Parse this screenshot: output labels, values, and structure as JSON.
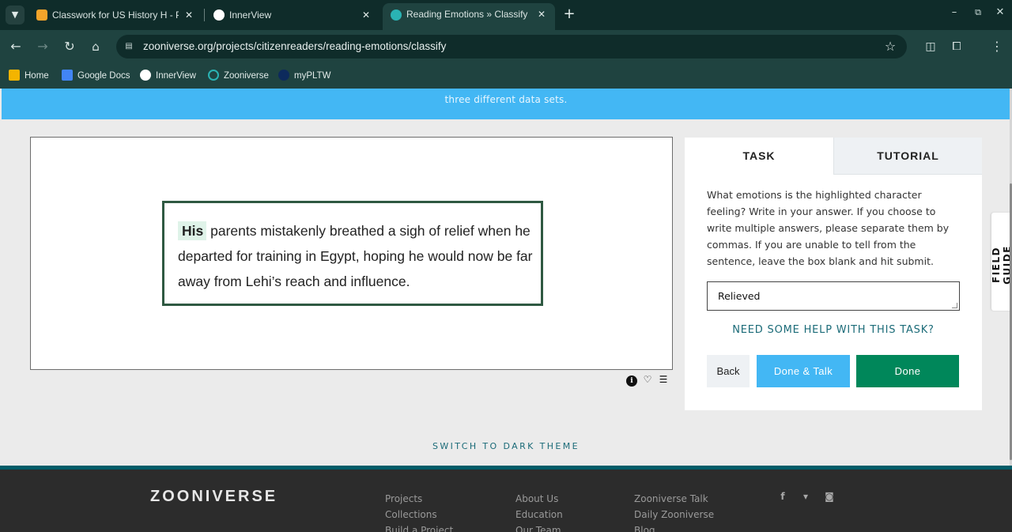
{
  "browser": {
    "tabs": [
      {
        "title": "Classwork for US History H - P",
        "icon": "google-classroom-icon",
        "color": "#f4a42a"
      },
      {
        "title": "InnerView",
        "icon": "innerview-icon",
        "color": "#ffffff"
      },
      {
        "title": "Reading Emotions » Classify —",
        "icon": "zooniverse-icon",
        "color": "#2ab3b3"
      }
    ],
    "address": "zooniverse.org/projects/citizenreaders/reading-emotions/classify",
    "bookmarks": [
      {
        "label": "Home",
        "icon": "google-classroom-icon"
      },
      {
        "label": "Google Docs",
        "icon": "google-docs-icon"
      },
      {
        "label": "InnerView",
        "icon": "innerview-icon"
      },
      {
        "label": "Zooniverse",
        "icon": "zooniverse-icon"
      },
      {
        "label": "myPLTW",
        "icon": "pltw-icon"
      }
    ]
  },
  "banner": {
    "text": "three different data sets."
  },
  "subject": {
    "highlight": "His",
    "sentence": "parents mistakenly breathed a sigh of relief when he departed for training in Egypt, hoping he would now be far away from Lehi’s reach and influence."
  },
  "task": {
    "tabs": {
      "task": "TASK",
      "tutorial": "TUTORIAL"
    },
    "instructions": "What emotions is the highlighted character feeling? Write in your answer. If you choose to write multiple answers, please separate them by commas. If you are unable to tell from the sentence, leave the box blank and hit submit.",
    "answer": "Relieved",
    "help": "NEED SOME HELP WITH THIS TASK?",
    "back": "Back",
    "done_talk": "Done & Talk",
    "done": "Done"
  },
  "field_guide": "FIELD GUIDE",
  "theme_link": "SWITCH TO DARK THEME",
  "footer": {
    "logo": "ZOONIVERSE",
    "col1": [
      "Projects",
      "Collections",
      "Build a Project"
    ],
    "col2": [
      "About Us",
      "Education",
      "Our Team"
    ],
    "col3": [
      "Zooniverse Talk",
      "Daily Zooniverse",
      "Blog"
    ],
    "social": [
      "facebook-icon",
      "twitter-icon",
      "instagram-icon"
    ]
  },
  "colors": {
    "chrome_dark": "#0f2c2a",
    "chrome": "#1f4340",
    "banner": "#43b7f4",
    "done": "#00875a",
    "link": "#1b6b78"
  }
}
